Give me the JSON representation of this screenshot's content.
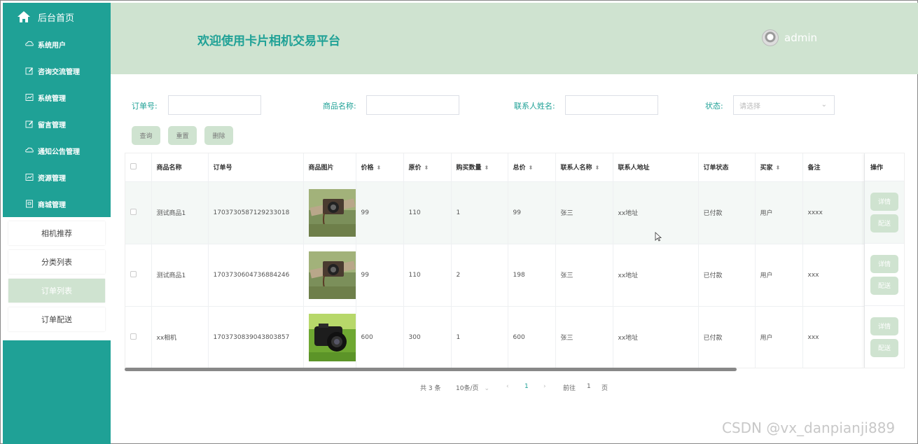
{
  "sidebar": {
    "home_label": "后台首页",
    "menu": [
      {
        "label": "系统用户",
        "icon": "cloud-icon"
      },
      {
        "label": "咨询交流管理",
        "icon": "edit-icon"
      },
      {
        "label": "系统管理",
        "icon": "chart-icon"
      },
      {
        "label": "留言管理",
        "icon": "edit-icon"
      },
      {
        "label": "通知公告管理",
        "icon": "cloud-icon"
      },
      {
        "label": "资源管理",
        "icon": "chart-icon"
      },
      {
        "label": "商城管理",
        "icon": "box-icon"
      }
    ],
    "submenu": [
      "相机推荐",
      "分类列表",
      "订单列表",
      "订单配送"
    ],
    "active_submenu": "订单列表"
  },
  "header": {
    "title": "欢迎使用卡片相机交易平台",
    "user": "admin"
  },
  "search": {
    "order_no_label": "订单号:",
    "product_name_label": "商品名称:",
    "contact_name_label": "联系人姓名:",
    "status_label": "状态:",
    "status_placeholder": "请选择",
    "query_button": "查询",
    "reset_button": "重置",
    "delete_button": "删除"
  },
  "table": {
    "headers": [
      "商品名称",
      "订单号",
      "商品图片",
      "价格",
      "原价",
      "购买数量",
      "总价",
      "联系人名称",
      "联系人地址",
      "订单状态",
      "买家",
      "备注",
      "操作"
    ],
    "rows": [
      {
        "name": "测试商品1",
        "order_no": "1703730587129233018",
        "image": "vintage-camera-photo",
        "price": "99",
        "original_price": "110",
        "qty": "1",
        "total": "99",
        "contact": "张三",
        "address": "xx地址",
        "status": "已付款",
        "buyer": "用户",
        "remark": "xxxx"
      },
      {
        "name": "测试商品1",
        "order_no": "1703730604736884246",
        "image": "vintage-camera-photo",
        "price": "99",
        "original_price": "110",
        "qty": "2",
        "total": "198",
        "contact": "张三",
        "address": "xx地址",
        "status": "已付款",
        "buyer": "用户",
        "remark": "xxx"
      },
      {
        "name": "xx相机",
        "order_no": "1703730839043803857",
        "image": "dslr-camera-photo",
        "price": "600",
        "original_price": "300",
        "qty": "1",
        "total": "600",
        "contact": "张三",
        "address": "xx地址",
        "status": "已付款",
        "buyer": "用户",
        "remark": "xxx"
      }
    ],
    "detail_button": "详情",
    "ship_button": "配送"
  },
  "pagination": {
    "total": "共 3 条",
    "page_size": "10条/页",
    "current_page": "1",
    "goto_label": "前往",
    "goto_value": "1",
    "page_suffix": "页"
  },
  "watermark": "CSDN @vx_danpianji889",
  "colors": {
    "primary": "#1fa196",
    "light": "#cfe3d0"
  }
}
